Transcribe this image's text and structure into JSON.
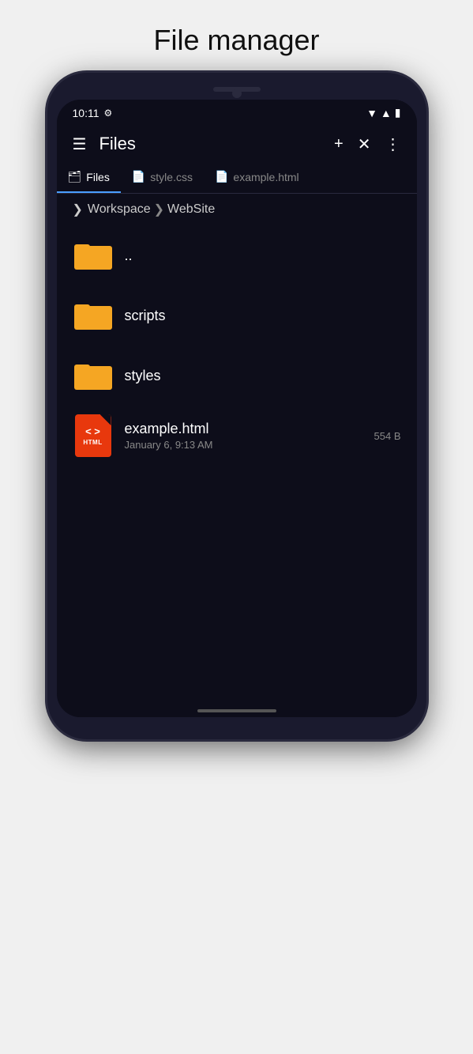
{
  "page": {
    "title": "File manager"
  },
  "status_bar": {
    "time": "10:11",
    "gear": "⚙"
  },
  "header": {
    "title": "Files",
    "add_label": "+",
    "close_label": "✕",
    "menu_label": "⋮"
  },
  "tabs": [
    {
      "id": "files",
      "label": "Files",
      "icon": "📁",
      "active": true
    },
    {
      "id": "style-css",
      "label": "style.css",
      "icon": "📄",
      "active": false
    },
    {
      "id": "example-html",
      "label": "example.html",
      "icon": "📄",
      "active": false
    }
  ],
  "breadcrumb": {
    "workspace": "Workspace",
    "website": "WebSite"
  },
  "files": [
    {
      "id": "parent",
      "name": "..",
      "type": "folder",
      "meta": "",
      "size": ""
    },
    {
      "id": "scripts",
      "name": "scripts",
      "type": "folder",
      "meta": "",
      "size": ""
    },
    {
      "id": "styles",
      "name": "styles",
      "type": "folder",
      "meta": "",
      "size": ""
    },
    {
      "id": "example-html",
      "name": "example.html",
      "type": "html",
      "meta": "January 6, 9:13 AM",
      "size": "554 B"
    }
  ]
}
